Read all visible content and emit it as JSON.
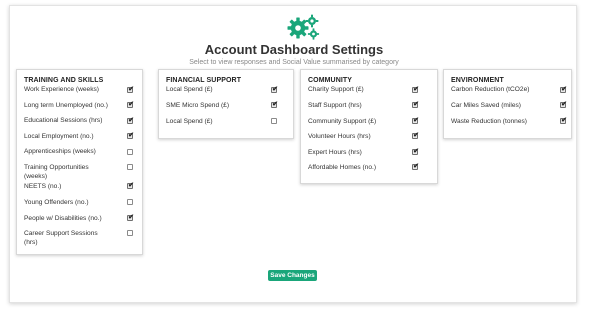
{
  "header": {
    "title": "Account Dashboard Settings",
    "subtitle": "Select to view responses and Social Value summarised by category",
    "icon": "gears-icon",
    "accent_color": "#1aa67a"
  },
  "categories": [
    {
      "title": "TRAINING AND SKILLS",
      "items": [
        {
          "label": "Work Experience (weeks)",
          "checked": true
        },
        {
          "label": "Long term Unemployed (no.)",
          "checked": true
        },
        {
          "label": "Educational Sessions (hrs)",
          "checked": true
        },
        {
          "label": "Local Employment (no.)",
          "checked": true
        },
        {
          "label": "Apprenticeships (weeks)",
          "checked": false
        },
        {
          "label": "Training Opportunities (weeks)",
          "checked": false
        },
        {
          "label": "NEETS (no.)",
          "checked": true
        },
        {
          "label": "Young Offenders (no.)",
          "checked": false
        },
        {
          "label": "People w/ Disabilities (no.)",
          "checked": true
        },
        {
          "label": "Career Support Sessions (hrs)",
          "checked": false
        }
      ]
    },
    {
      "title": "FINANCIAL SUPPORT",
      "items": [
        {
          "label": "Local Spend (£)",
          "checked": true
        },
        {
          "label": "SME Micro Spend (£)",
          "checked": true
        },
        {
          "label": "Local Spend (£)",
          "checked": false
        }
      ]
    },
    {
      "title": "COMMUNITY",
      "items": [
        {
          "label": "Charity Support (£)",
          "checked": true
        },
        {
          "label": "Staff Support (hrs)",
          "checked": true
        },
        {
          "label": "Community Support (£)",
          "checked": true
        },
        {
          "label": "Volunteer Hours (hrs)",
          "checked": true
        },
        {
          "label": "Expert Hours (hrs)",
          "checked": true
        },
        {
          "label": "Affordable Homes (no.)",
          "checked": true
        }
      ]
    },
    {
      "title": "ENVIRONMENT",
      "items": [
        {
          "label": "Carbon Reduction (tCO2e)",
          "checked": true
        },
        {
          "label": "Car Miles Saved (miles)",
          "checked": true
        },
        {
          "label": "Waste Reduction (tonnes)",
          "checked": true
        }
      ]
    }
  ],
  "actions": {
    "save_label": "Save Changes"
  }
}
